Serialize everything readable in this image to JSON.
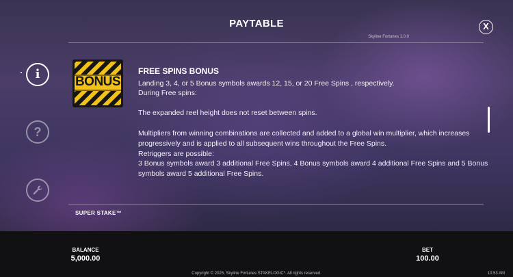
{
  "header": {
    "title": "PAYTABLE",
    "version": "Skyline Fortunes 1.0.0",
    "close_label": "X"
  },
  "sidebar": {
    "info_label": "i",
    "help_label": "?"
  },
  "free_spins": {
    "symbol_label": "BONUS",
    "title": "FREE SPINS BONUS",
    "lines": [
      "Landing 3, 4, or 5 Bonus symbols awards 12, 15, or 20 Free Spins , respectively.",
      "During Free spins:",
      "",
      "The expanded reel height does not reset between spins.",
      "",
      "Multipliers from winning combinations are collected and added to a global win multiplier, which increases",
      "progressively and is applied to all subsequent wins throughout the Free Spins.",
      "Retriggers are possible:",
      "3 Bonus symbols award 3 additional Free Spins, 4 Bonus symbols award 4 additional Free Spins and 5 Bonus",
      "symbols award 5 additional Free Spins."
    ]
  },
  "next_section": {
    "title": "SUPER STAKE™"
  },
  "footer": {
    "balance_label": "BALANCE",
    "balance_value": "5,000.00",
    "bet_label": "BET",
    "bet_value": "100.00",
    "copyright": "Copyright © 2025, Skyline Fortunes STAKELOGIC*. All rights reserved.",
    "clock": "10:53 AM"
  },
  "colors": {
    "bonus_yellow": "#f2c21b",
    "bonus_black": "#161616",
    "bottom_bar": "#111013"
  }
}
